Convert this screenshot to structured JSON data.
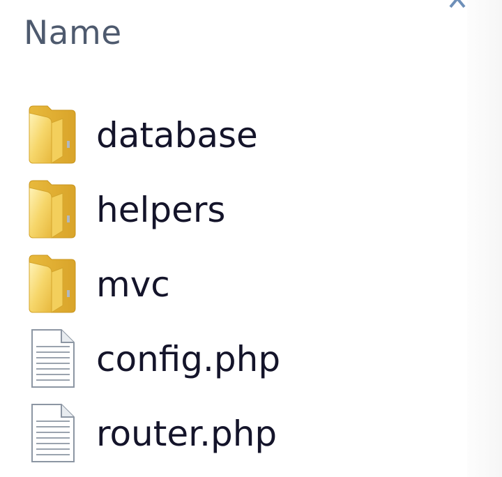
{
  "header": {
    "name_column": "Name",
    "sort": "ascending"
  },
  "items": [
    {
      "name": "database",
      "type": "folder",
      "icon": "folder-icon"
    },
    {
      "name": "helpers",
      "type": "folder",
      "icon": "folder-icon"
    },
    {
      "name": "mvc",
      "type": "folder",
      "icon": "folder-icon"
    },
    {
      "name": "config.php",
      "type": "file",
      "icon": "document-icon"
    },
    {
      "name": "router.php",
      "type": "file",
      "icon": "document-icon"
    }
  ],
  "colors": {
    "header_text": "#4e5a6e",
    "item_text": "#14142a",
    "folder_yellow": "#f2cf5c",
    "sort_arrow": "#6e8fb8"
  }
}
